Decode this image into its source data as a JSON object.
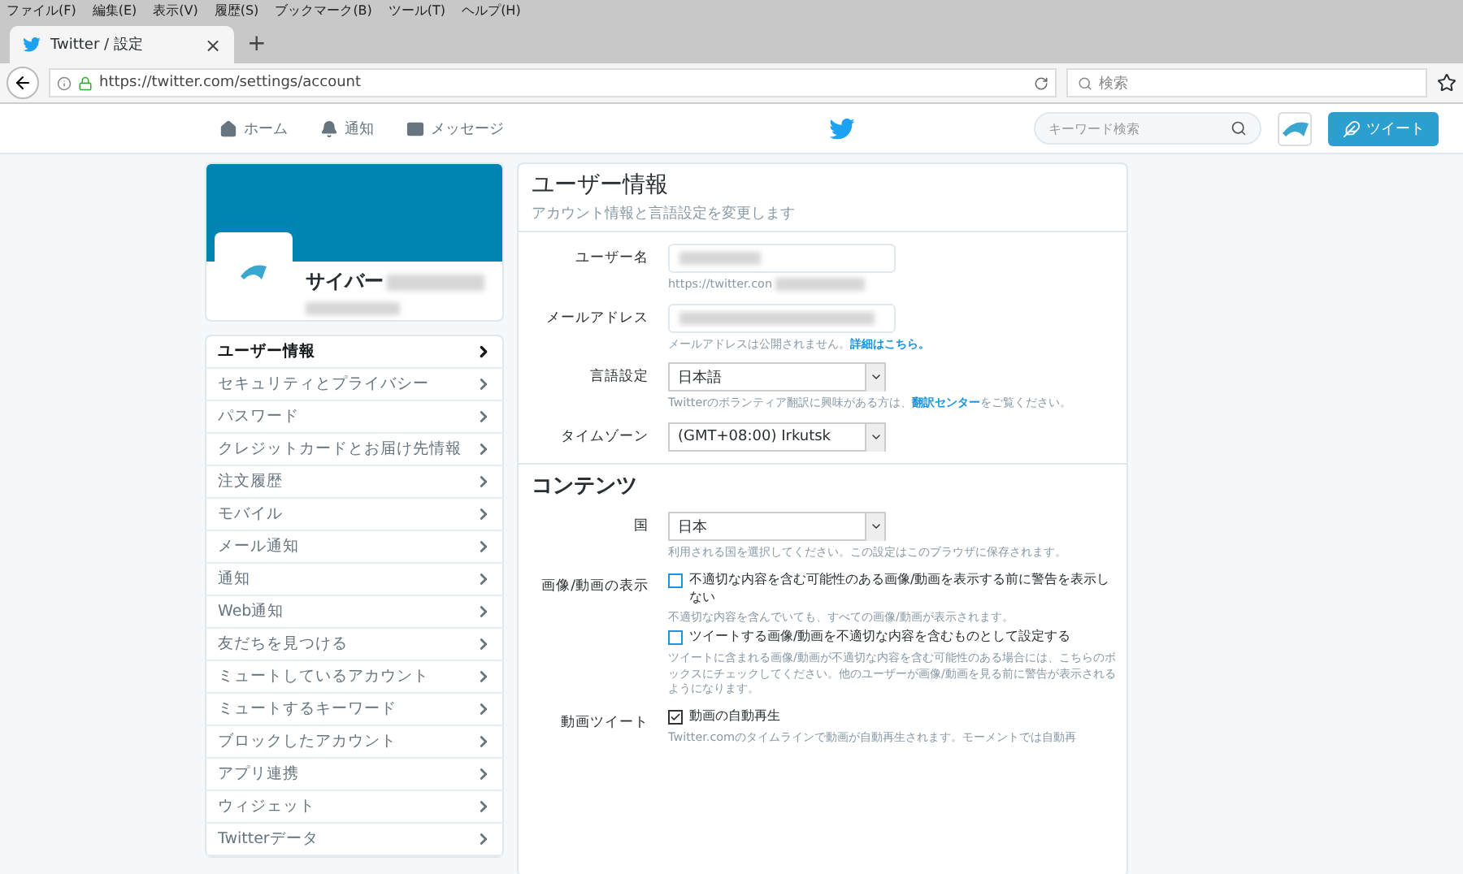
{
  "browser": {
    "menu": [
      "ファイル(F)",
      "編集(E)",
      "表示(V)",
      "履歴(S)",
      "ブックマーク(B)",
      "ツール(T)",
      "ヘルプ(H)"
    ],
    "tab": {
      "title": "Twitter / 設定",
      "close": "×"
    },
    "new_tab": "+",
    "url": "https://twitter.com/settings/account",
    "search_placeholder": "検索"
  },
  "nav": {
    "items": [
      {
        "kind": "home",
        "label": "ホーム"
      },
      {
        "kind": "bell",
        "label": "通知"
      },
      {
        "kind": "mail",
        "label": "メッセージ"
      }
    ],
    "search_placeholder": "キーワード検索",
    "tweet_button": "ツイート"
  },
  "profile": {
    "name": "サイバー"
  },
  "sidebar": {
    "items": [
      {
        "label": "ユーザー情報",
        "selected": true
      },
      {
        "label": "セキュリティとプライバシー",
        "selected": false
      },
      {
        "label": "パスワード",
        "selected": false
      },
      {
        "label": "クレジットカードとお届け先情報",
        "selected": false
      },
      {
        "label": "注文履歴",
        "selected": false
      },
      {
        "label": "モバイル",
        "selected": false
      },
      {
        "label": "メール通知",
        "selected": false
      },
      {
        "label": "通知",
        "selected": false
      },
      {
        "label": "Web通知",
        "selected": false
      },
      {
        "label": "友だちを見つける",
        "selected": false
      },
      {
        "label": "ミュートしているアカウント",
        "selected": false
      },
      {
        "label": "ミュートするキーワード",
        "selected": false
      },
      {
        "label": "ブロックしたアカウント",
        "selected": false
      },
      {
        "label": "アプリ連携",
        "selected": false
      },
      {
        "label": "ウィジェット",
        "selected": false
      },
      {
        "label": "Twitterデータ",
        "selected": false
      }
    ]
  },
  "main": {
    "title": "ユーザー情報",
    "subtitle": "アカウント情報と言語設定を変更します",
    "account_rows": [
      {
        "kind": "text",
        "label": "ユーザー名",
        "hint": "https://twitter.con"
      },
      {
        "kind": "text",
        "label": "メールアドレス",
        "hint": "メールアドレスは公開されません。",
        "link": "詳細はこちら。"
      },
      {
        "kind": "select",
        "label": "言語設定",
        "value": "日本語",
        "hint": "Twitterのボランティア翻訳に興味がある方は、",
        "link": "翻訳センター",
        "hint_after": "をご覧ください。"
      },
      {
        "kind": "select",
        "label": "タイムゾーン",
        "value": "(GMT+08:00) Irkutsk"
      }
    ],
    "content_title": "コンテンツ",
    "country": {
      "label": "国",
      "value": "日本",
      "hint": "利用される国を選択してください。この設定はこのブラウザに保存されます。"
    },
    "media": {
      "label": "画像/動画の表示",
      "options": [
        {
          "label": "不適切な内容を含む可能性のある画像/動画を表示する前に警告を表示しない",
          "checked": false,
          "hint": "不適切な内容を含んでいても、すべての画像/動画が表示されます。"
        },
        {
          "label": "ツイートする画像/動画を不適切な内容を含むものとして設定する",
          "checked": false,
          "hint": "ツイートに含まれる画像/動画が不適切な内容を含む可能性のある場合には、こちらのボックスにチェックしてください。他のユーザーが画像/動画を見る前に警告が表示されるようになります。"
        }
      ]
    },
    "video": {
      "label": "動画ツイート",
      "option": {
        "label": "動画の自動再生",
        "checked": true,
        "hint": "Twitter.comのタイムラインで動画が自動再生されます。モーメントでは自動再"
      }
    }
  }
}
